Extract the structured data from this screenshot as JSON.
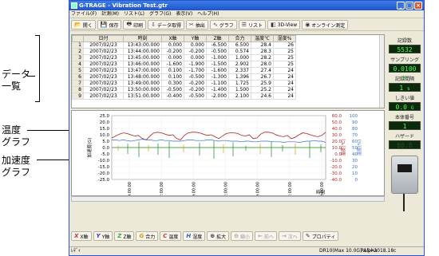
{
  "annotations": {
    "data_list": "データ\n一覧",
    "temp_graph": "温度\nグラフ",
    "accel_graph": "加速度\nグラフ"
  },
  "window": {
    "title": "G-TRAGE - Vibration Test.gtr"
  },
  "menu": [
    "ファイル(F)",
    "計測(M)",
    "リスト(L)",
    "グラフ(G)",
    "表示(V)",
    "ヘルプ(H)"
  ],
  "toolbar": [
    {
      "icon": "folder-open-icon",
      "label": "開く"
    },
    {
      "icon": "save-icon",
      "label": "保存"
    },
    {
      "icon": "print-icon",
      "label": "印刷"
    },
    {
      "icon": "data-acquire-icon",
      "label": "データ取得"
    },
    {
      "icon": "extract-icon",
      "label": "抽出"
    },
    {
      "icon": "graph-icon",
      "label": "グラフ"
    },
    {
      "icon": "list-icon",
      "label": "リスト"
    },
    {
      "icon": "3d-view-icon",
      "label": "3D-View"
    },
    {
      "icon": "online-icon",
      "label": "オンライン測定"
    }
  ],
  "table": {
    "headers": [
      "",
      "日付",
      "時刻",
      "X軸",
      "Y軸",
      "Z軸",
      "合力",
      "温度℃",
      "湿度%"
    ],
    "rows": [
      [
        "1",
        "2007/02/23",
        "13:43:00.000",
        "0.000",
        "0.000",
        "-6.500",
        "6.500",
        "28.4",
        "26"
      ],
      [
        "2",
        "2007/02/23",
        "13:44:00.000",
        "-0.200",
        "-0.200",
        "-0.500",
        "0.574",
        "28.3",
        "25"
      ],
      [
        "3",
        "2007/02/23",
        "13:45:00.000",
        "0.000",
        "0.000",
        "-1.000",
        "1.000",
        "28.2",
        "25"
      ],
      [
        "4",
        "2007/02/23",
        "13:46:00.000",
        "-1.600",
        "-1.900",
        "-1.500",
        "2.902",
        "28.0",
        "25"
      ],
      [
        "5",
        "2007/02/23",
        "13:47:00.000",
        "0.100",
        "-1.700",
        "-1.600",
        "2.337",
        "27.4",
        "24"
      ],
      [
        "6",
        "2007/02/23",
        "13:48:00.000",
        "0.100",
        "-0.500",
        "-1.300",
        "1.396",
        "26.7",
        "24"
      ],
      [
        "7",
        "2007/02/23",
        "13:49:00.000",
        "0.300",
        "-0.200",
        "-1.100",
        "1.725",
        "25.9",
        "24"
      ],
      [
        "8",
        "2007/02/23",
        "13:50:00.000",
        "-0.500",
        "-0.200",
        "-1.400",
        "1.500",
        "25.2",
        "24"
      ],
      [
        "9",
        "2007/02/23",
        "13:51:00.000",
        "-0.400",
        "-0.500",
        "-2.000",
        "2.100",
        "24.6",
        "24"
      ]
    ]
  },
  "panel": {
    "record_count_label": "記録数",
    "record_count": "5532",
    "sampling_label": "サンプリング",
    "sampling": "0.0100",
    "sampling_unit": "秒",
    "interval_label": "記録間隔",
    "interval": "1",
    "interval_unit": "s",
    "threshold_label": "しきい値",
    "threshold": "0.0",
    "threshold_unit": "G",
    "serial_label": "本体番号",
    "serial": "1",
    "hazard_label": "ハザード",
    "hazard": "88.8"
  },
  "chart_data": {
    "type": "line",
    "yleft": {
      "ticks": [
        "25.0",
        "20.0",
        "15.0",
        "10.0",
        "5.0",
        "0.0",
        "-5.0",
        "-10.0",
        "-15.0",
        "-20.0",
        "-25.0"
      ],
      "label": "加速度(G)",
      "range": [
        -25,
        25
      ]
    },
    "yright1": {
      "ticks": [
        "60.0",
        "50.0",
        "40.0",
        "30.0",
        "20.0",
        "10.0",
        "0.0",
        "-10.0",
        "-20.0",
        "-30.0",
        "-40.0"
      ],
      "label": "温度(℃)"
    },
    "yright2": {
      "ticks": [
        "100",
        "90",
        "80",
        "70",
        "60",
        "50",
        "40",
        "30",
        "20",
        "10",
        "0"
      ],
      "label": "湿度(%)"
    },
    "xticks": [
      "2/24 00:00:00",
      "12:00:00",
      "2/25 00:00:00",
      "12:00:00",
      "2/26 00:00:00",
      "12:00:00",
      "2/27 00:00:00"
    ],
    "xlabel": "時刻",
    "series": [
      {
        "color": "#b21e1e",
        "temp_values": [
          25,
          28,
          31,
          33,
          32,
          30,
          28,
          29,
          24,
          22,
          28,
          33,
          34,
          33,
          31,
          29,
          30,
          24,
          22,
          29,
          33,
          34,
          34,
          33,
          31,
          29,
          30,
          27,
          24,
          28,
          32,
          33,
          33,
          32,
          29,
          28,
          30,
          24,
          25,
          31,
          34,
          34,
          33,
          30,
          28,
          27,
          29,
          24,
          26,
          30,
          33,
          32,
          30,
          28,
          27,
          29,
          34
        ]
      },
      {
        "color": "#3a6fc8",
        "humidity_values": [
          62,
          62,
          61,
          62,
          61,
          60,
          61,
          62,
          63,
          62,
          62,
          61,
          61,
          62,
          61,
          61,
          60,
          60,
          60,
          61,
          62,
          62,
          61,
          61,
          61,
          62,
          62,
          61,
          60,
          61,
          61,
          60,
          60,
          60,
          59,
          60,
          60,
          59,
          59,
          60,
          60,
          60,
          59,
          59,
          59,
          58,
          59,
          59,
          59,
          58,
          59,
          60,
          60,
          61,
          60,
          60,
          58
        ]
      }
    ]
  },
  "bottom": [
    {
      "icon": "x-axis-icon",
      "label": "X軸",
      "color": "#c33"
    },
    {
      "icon": "y-axis-icon",
      "label": "Y軸",
      "color": "#33c"
    },
    {
      "icon": "z-axis-icon",
      "label": "Z軸",
      "color": "#3a3"
    },
    {
      "icon": "resultant-icon",
      "label": "合力",
      "color": "#c90"
    },
    {
      "icon": "temp-icon",
      "label": "温度",
      "color": "#c33"
    },
    {
      "icon": "humidity-icon",
      "label": "湿度",
      "color": "#36c"
    },
    {
      "icon": "zoom-in-icon",
      "label": "拡大",
      "color": "#333"
    },
    {
      "icon": "zoom-out-icon",
      "label": "縮小",
      "color": "#999"
    },
    {
      "icon": "prev-icon",
      "label": "前へ",
      "color": "#999"
    },
    {
      "icon": "next-icon",
      "label": "次へ",
      "color": "#999"
    },
    {
      "icon": "property-icon",
      "label": "プロパティ",
      "color": "#333"
    }
  ],
  "status": {
    "left": "ﾚﾃﾞｨ",
    "device": "DR10(Max 10.0G) Alpha",
    "version": "RLS=2018.18c"
  }
}
